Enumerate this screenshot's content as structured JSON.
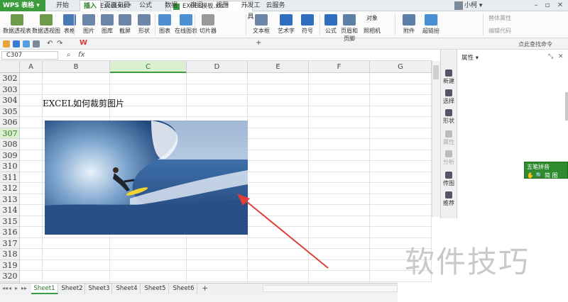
{
  "app": {
    "name": "WPS 表格",
    "user": "小柯"
  },
  "menu": {
    "tabs": [
      "开始",
      "插入",
      "页面布局",
      "公式",
      "数据",
      "审阅",
      "视图",
      "开发工具",
      "云服务"
    ],
    "active": "插入"
  },
  "ribbon": {
    "buttons": [
      "数据透视表",
      "数据透视图",
      "表格",
      "图片",
      "图库",
      "截屏",
      "形状",
      "图表",
      "在线图表",
      "切片器",
      "文本框",
      "艺术字",
      "符号",
      "公式",
      "页眉和页脚",
      "对象",
      "照相机",
      "附件",
      "超链接"
    ],
    "disabled_right": [
      "替体属性",
      "编辑代码"
    ]
  },
  "doc_tabs": [
    {
      "label": "Excel.xls *",
      "active": false
    },
    {
      "label": "EXCEL模板.xls *",
      "active": true
    }
  ],
  "search_hint": "点此查找命令",
  "formula_bar": {
    "name_box": "C307",
    "fx": "fx"
  },
  "grid": {
    "columns": [
      "A",
      "B",
      "C",
      "D",
      "E",
      "F",
      "G"
    ],
    "selected_column": "C",
    "rows": [
      "302",
      "303",
      "304",
      "305",
      "306",
      "307",
      "308",
      "309",
      "310",
      "311",
      "312",
      "313",
      "314",
      "315",
      "316",
      "317",
      "318",
      "319"
    ],
    "selected_row": "307",
    "partial_row": "320",
    "cell_text": "EXCEL如何裁剪图片"
  },
  "side_panel": {
    "buttons": [
      {
        "label": "新建",
        "icon": "new-icon",
        "disabled": false
      },
      {
        "label": "选择",
        "icon": "select-icon",
        "disabled": false
      },
      {
        "label": "形状",
        "icon": "shape-icon",
        "disabled": false
      },
      {
        "label": "属性",
        "icon": "property-icon",
        "disabled": true
      },
      {
        "label": "分析",
        "icon": "analysis-icon",
        "disabled": true
      },
      {
        "label": "传图",
        "icon": "upload-image-icon",
        "disabled": false
      },
      {
        "label": "推荐",
        "icon": "recommend-icon",
        "disabled": false
      }
    ],
    "property_title": "属性"
  },
  "ime": {
    "title": "五笔拼音",
    "labels": [
      "简",
      "图"
    ]
  },
  "sheet_tabs": [
    "Sheet1",
    "Sheet2",
    "Sheet3",
    "Sheet4",
    "Sheet5",
    "Sheet6"
  ],
  "active_sheet": "Sheet1",
  "watermark": "软件技巧",
  "colors": {
    "accent": "#3c9b3c",
    "arrow": "#e0403a"
  }
}
